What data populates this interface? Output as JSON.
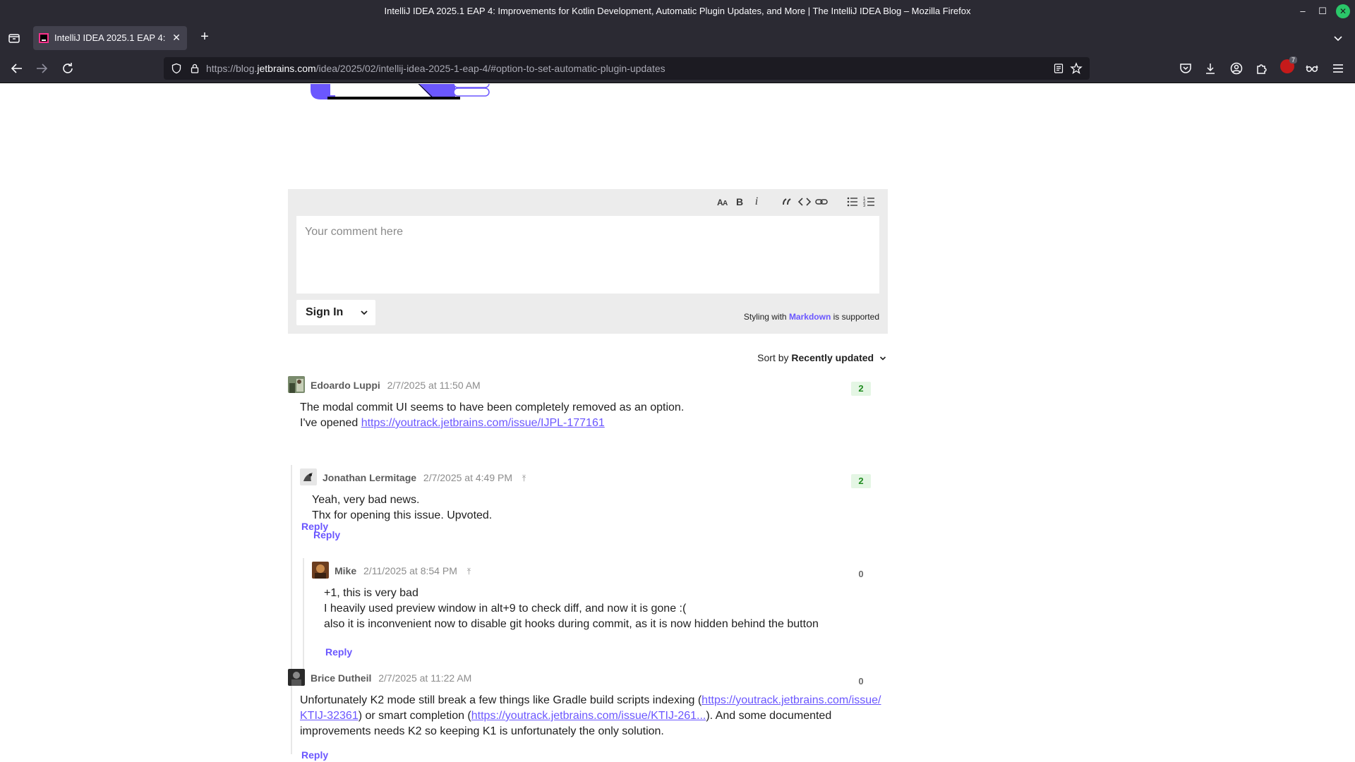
{
  "window": {
    "title": "IntelliJ IDEA 2025.1 EAP 4: Improvements for Kotlin Development, Automatic Plugin Updates, and More  | The IntelliJ IDEA Blog – Mozilla Firefox"
  },
  "tab": {
    "title": "IntelliJ IDEA 2025.1 EAP 4: I"
  },
  "urlbar": {
    "url_prefix": "https://blog.",
    "url_domain": "jetbrains.com",
    "url_path": "/idea/2025/02/intellij-idea-2025-1-eap-4/#option-to-set-automatic-plugin-updates"
  },
  "extensions": {
    "badge_count": "7"
  },
  "editor": {
    "placeholder": "Your comment here",
    "toolbar_icons": [
      "text-size-icon",
      "bold-icon",
      "italic-icon",
      "quote-icon",
      "code-icon",
      "link-icon",
      "bulleted-list-icon",
      "numbered-list-icon"
    ],
    "bold_glyph": "B",
    "italic_glyph": "i",
    "signin_label": "Sign In",
    "markdown_prefix": "Styling with ",
    "markdown_link": "Markdown",
    "markdown_suffix": " is supported"
  },
  "sort": {
    "label": "Sort by",
    "value": "Recently updated"
  },
  "comments": [
    {
      "author": "Edoardo Luppi",
      "date": "2/7/2025 at 11:50 AM",
      "votes": "2",
      "line1": "The modal commit UI seems to have been completely removed as an option.",
      "line2_text": "I've opened ",
      "line2_link": "https://youtrack.jetbrains.com/issue/IJPL-177161",
      "reply": "Reply"
    },
    {
      "author": "Jonathan Lermitage",
      "date": "2/7/2025 at 4:49 PM",
      "votes": "2",
      "line1": "Yeah, very bad news.",
      "line2": "Thx for opening this issue. Upvoted.",
      "reply": "Reply"
    },
    {
      "author": "Mike",
      "date": "2/11/2025 at 8:54 PM",
      "votes": "0",
      "line1": "+1, this is very bad",
      "line2": "I heavily used preview window in alt+9 to check diff, and now it is gone :(",
      "line3": "also it is inconvenient now to disable git hooks during commit, as it is now hidden behind the button",
      "reply": "Reply"
    },
    {
      "author": "Brice Dutheil",
      "date": "2/7/2025 at 11:22 AM",
      "votes": "0",
      "text1": "Unfortunately K2 mode still break a few things like Gradle build scripts indexing (",
      "link1a": "https://youtrack.jetbrains.com/issue/",
      "link1b": "KTIJ-32361",
      "text2": ") or smart completion (",
      "link2": "https://youtrack.jetbrains.com/issue/KTIJ-261...",
      "text3": "). And some documented",
      "text4": "improvements needs K2 so keeping K1 is unfortunately the only solution.",
      "reply": "Reply"
    }
  ],
  "colors": {
    "accent": "#6b57ff",
    "vote_positive_bg": "#e4f6e4",
    "vote_positive_fg": "#1e8a1e",
    "chrome_bg": "#2b2a33",
    "urlbar_bg": "#1c1b22",
    "editor_bg": "#ececec"
  }
}
